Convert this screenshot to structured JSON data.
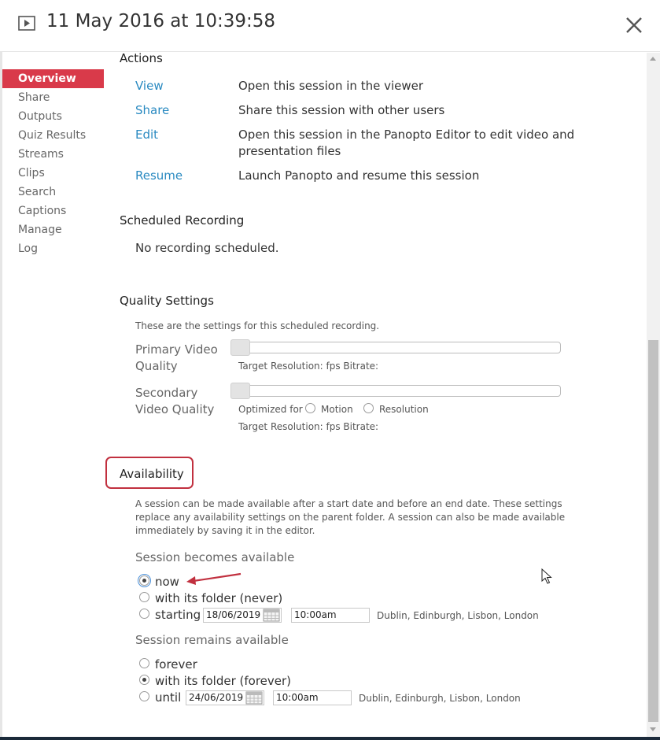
{
  "header": {
    "title": "11 May 2016 at 10:39:58"
  },
  "sidebar": {
    "items": [
      {
        "label": "Overview"
      },
      {
        "label": "Share"
      },
      {
        "label": "Outputs"
      },
      {
        "label": "Quiz Results"
      },
      {
        "label": "Streams"
      },
      {
        "label": "Clips"
      },
      {
        "label": "Search"
      },
      {
        "label": "Captions"
      },
      {
        "label": "Manage"
      },
      {
        "label": "Log"
      }
    ]
  },
  "actions": {
    "title": "Actions",
    "items": [
      {
        "link": "View",
        "desc": "Open this session in the viewer"
      },
      {
        "link": "Share",
        "desc": "Share this session with other users"
      },
      {
        "link": "Edit",
        "desc_line1": "Open this session in the Panopto Editor to edit video and",
        "desc_line2": "presentation files"
      },
      {
        "link": "Resume",
        "desc": "Launch Panopto and resume this session"
      }
    ]
  },
  "scheduled": {
    "title": "Scheduled Recording",
    "text": "No recording scheduled."
  },
  "quality": {
    "title": "Quality Settings",
    "intro": "These are the settings for this scheduled recording.",
    "primary_label_1": "Primary Video",
    "primary_label_2": "Quality",
    "primary_target": "Target Resolution:   fps Bitrate:",
    "secondary_label_1": "Secondary",
    "secondary_label_2": "Video Quality",
    "optimized_for": "Optimized for",
    "opt_motion": "Motion",
    "opt_resolution": "Resolution",
    "secondary_target": "Target Resolution:   fps Bitrate:"
  },
  "availability": {
    "title": "Availability",
    "desc_line1": "A session can be made available after a start date and before an end date. These settings",
    "desc_line2": "replace any availability settings on the parent folder. A session can also be made available",
    "desc_line3": "immediately by saving it in the editor.",
    "becomes_title": "Session becomes available",
    "becomes_now": "now",
    "becomes_folder": "with its folder (never)",
    "becomes_starting": "starting",
    "start_date": "18/06/2019",
    "start_time": "10:00am",
    "start_tz": "Dublin, Edinburgh, Lisbon, London",
    "remains_title": "Session remains available",
    "remains_forever": "forever",
    "remains_folder": "with its folder (forever)",
    "remains_until": "until",
    "end_date": "24/06/2019",
    "end_time": "10:00am",
    "end_tz": "Dublin, Edinburgh, Lisbon, London"
  },
  "colors": {
    "accent": "#d93a4a",
    "link": "#2a8ac1",
    "highlight": "#c1303f"
  }
}
